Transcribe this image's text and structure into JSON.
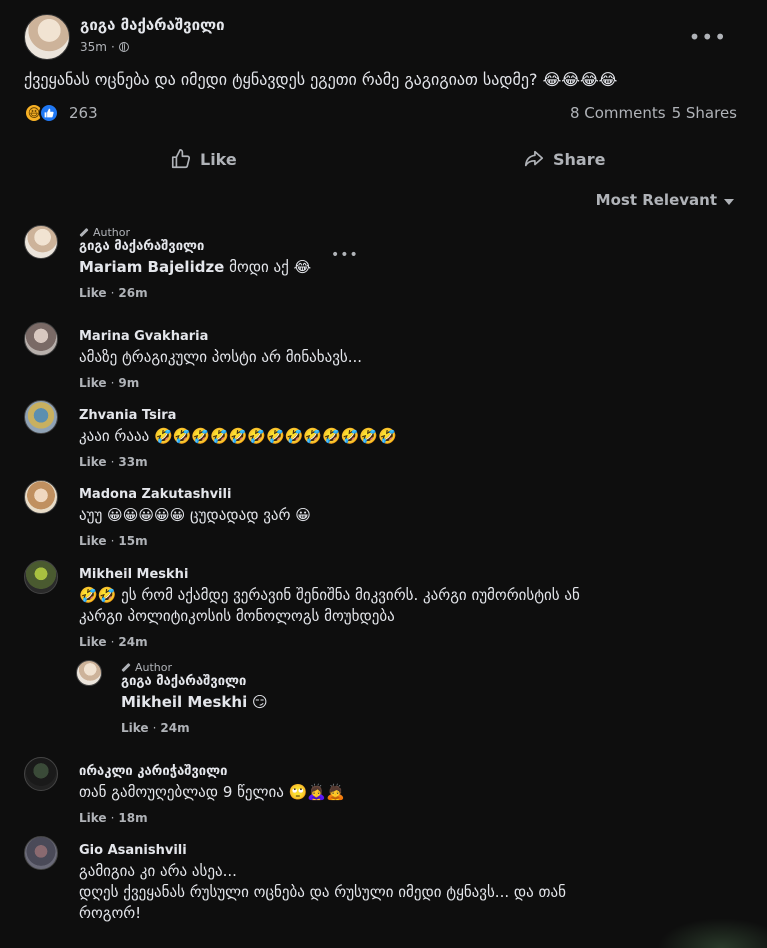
{
  "post": {
    "author": "გიგა მაქარაშვილი",
    "time": "35m",
    "separator": "·",
    "text": "ქვეყანას ოცნება და იმედი ტყნავდეს ეგეთი რამე გაგიგიათ სადმე? 😂😂😂😂",
    "reaction_count": "263",
    "comments_count": "8 Comments",
    "shares_count": "5 Shares",
    "more_label": "•••"
  },
  "actions": {
    "like": "Like",
    "share": "Share"
  },
  "sort": {
    "label": "Most Relevant"
  },
  "comments": [
    {
      "author_tag": "Author",
      "name": "გიგა მაქარაშვილი",
      "mention": "Mariam Bajelidze",
      "text_line1": " მოდი აქ 😂",
      "text_line2": "",
      "text_line3": "",
      "like": "Like",
      "time": "26m",
      "more": "•••"
    },
    {
      "name": "Marina Gvakharia",
      "text_line1": "ამაზე ტრაგიკული პოსტი არ მინახავს...",
      "like": "Like",
      "time": "9m"
    },
    {
      "name": "Zhvania Tsira",
      "text_line1": "კააი რააა 🤣🤣🤣🤣🤣🤣🤣🤣🤣🤣🤣🤣🤣",
      "like": "Like",
      "time": "33m"
    },
    {
      "name": "Madona Zakutashvili",
      "text_line1": "აუუ 😀😀😀😀😀 ცუდადად ვარ 😀",
      "like": "Like",
      "time": "15m"
    },
    {
      "name": "Mikheil Meskhi",
      "text_line1": "🤣🤣 ეს რომ აქამდე ვერავინ შენიშნა მიკვირს. კარგი იუმორისტის ან",
      "text_line2": "კარგი პოლიტიკოსის მონოლოგს მოუხდება",
      "like": "Like",
      "time": "24m"
    },
    {
      "author_tag": "Author",
      "name": "გიგა მაქარაშვილი",
      "mention": "Mikheil Meskhi",
      "text_line1": " 😏",
      "like": "Like",
      "time": "24m"
    },
    {
      "name": "ირაკლი კარიჭაშვილი",
      "text_line1": "თან გამოუღებლად 9 წელია 🙄🙇‍♀️🙇",
      "like": "Like",
      "time": "18m"
    },
    {
      "name": "Gio Asanishvili",
      "text_line1": "გამიგია კი არა ასეა...",
      "text_line2": "დღეს ქვეყანას რუსული ოცნება და რუსული იმედი ტყნავს... და თან",
      "text_line3": "როგორ!"
    }
  ],
  "colors": {
    "background": "#0e0e0e",
    "text_primary": "#e4e6eb",
    "text_secondary": "#b0b3b8",
    "like_blue": "#2078f4",
    "haha_yellow": "#f7b125"
  },
  "icons": {
    "more": "more-horizontal-icon",
    "globe": "globe-icon",
    "like": "thumbs-up-icon",
    "share": "share-arrow-icon",
    "caret": "caret-down-icon",
    "pencil": "pencil-icon"
  }
}
